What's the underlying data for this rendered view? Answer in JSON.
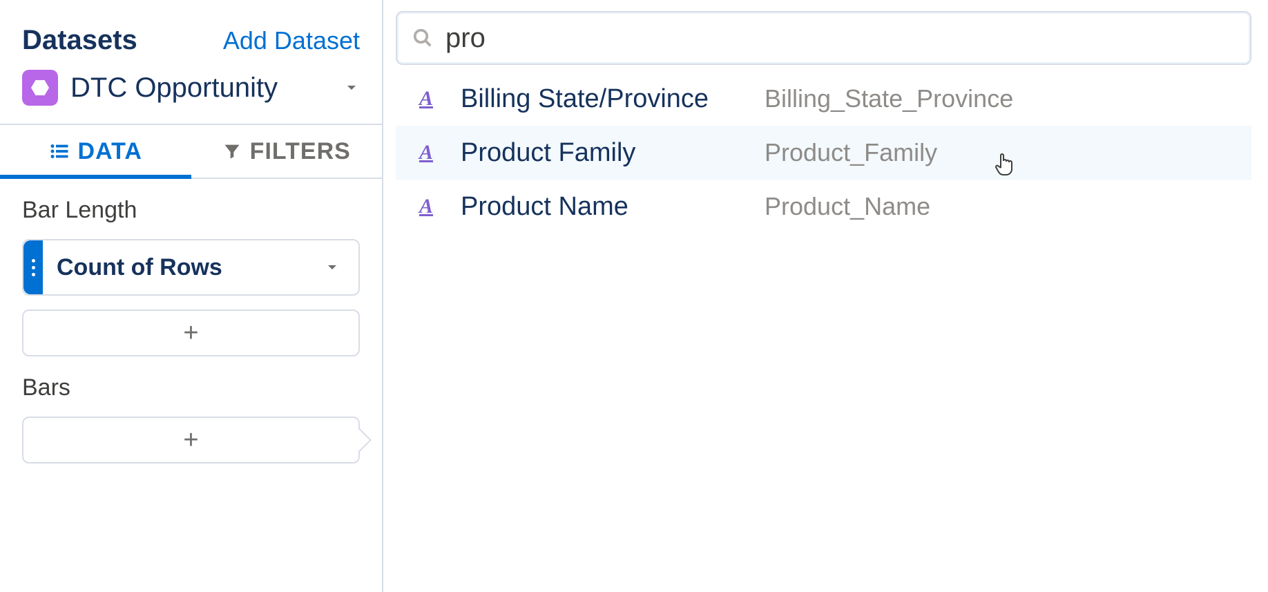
{
  "sidebar": {
    "datasets_title": "Datasets",
    "add_dataset_label": "Add Dataset",
    "selected_dataset": "DTC Opportunity"
  },
  "tabs": {
    "data": "DATA",
    "filters": "FILTERS"
  },
  "config": {
    "bar_length_title": "Bar Length",
    "bar_length_value": "Count of Rows",
    "bars_title": "Bars"
  },
  "search": {
    "value": "pro"
  },
  "results": [
    {
      "label": "Billing State/Province",
      "api": "Billing_State_Province",
      "hovered": false
    },
    {
      "label": "Product Family",
      "api": "Product_Family",
      "hovered": true
    },
    {
      "label": "Product Name",
      "api": "Product_Name",
      "hovered": false
    }
  ],
  "glyphs": {
    "plus": "+"
  }
}
